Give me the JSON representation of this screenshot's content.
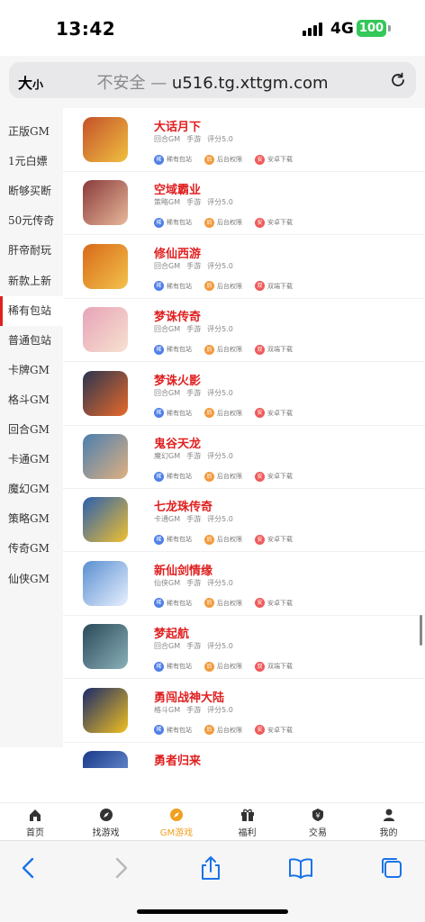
{
  "status": {
    "time": "13:42",
    "network": "4G",
    "battery": "100"
  },
  "browser": {
    "aa_big": "大",
    "aa_small": "小",
    "insecure": "不安全 — ",
    "domain": "u516.tg.xttgm.com"
  },
  "sidebar": {
    "items": [
      {
        "label": "正版GM"
      },
      {
        "label": "1元白嫖"
      },
      {
        "label": "断够买断"
      },
      {
        "label": "50元传奇"
      },
      {
        "label": "肝帝耐玩"
      },
      {
        "label": "新款上新"
      },
      {
        "label": "稀有包站"
      },
      {
        "label": "普通包站"
      },
      {
        "label": "卡牌GM"
      },
      {
        "label": "格斗GM"
      },
      {
        "label": "回合GM"
      },
      {
        "label": "卡通GM"
      },
      {
        "label": "魔幻GM"
      },
      {
        "label": "策略GM"
      },
      {
        "label": "传奇GM"
      },
      {
        "label": "仙侠GM"
      }
    ],
    "active_index": 6
  },
  "games": [
    {
      "name": "大话月下",
      "category": "回合GM",
      "type": "手游",
      "rating": "评分5.0",
      "tags": [
        "稀有包站",
        "后台权限",
        "安卓下载"
      ],
      "tag_icons": [
        "稀",
        "后",
        "安"
      ],
      "colors": [
        "#c4512a",
        "#f0c040"
      ]
    },
    {
      "name": "空域霸业",
      "category": "策略GM",
      "type": "手游",
      "rating": "评分5.0",
      "tags": [
        "稀有包站",
        "后台权限",
        "安卓下载"
      ],
      "tag_icons": [
        "稀",
        "后",
        "安"
      ],
      "colors": [
        "#8a3b3b",
        "#e8b89a"
      ]
    },
    {
      "name": "修仙西游",
      "category": "回合GM",
      "type": "手游",
      "rating": "评分5.0",
      "tags": [
        "稀有包站",
        "后台权限",
        "双端下载"
      ],
      "tag_icons": [
        "稀",
        "后",
        "双"
      ],
      "colors": [
        "#d86a1a",
        "#f3c24a"
      ]
    },
    {
      "name": "梦诛传奇",
      "category": "回合GM",
      "type": "手游",
      "rating": "评分5.0",
      "tags": [
        "稀有包站",
        "后台权限",
        "双端下载"
      ],
      "tag_icons": [
        "稀",
        "后",
        "双"
      ],
      "colors": [
        "#e7a3b8",
        "#f7e2d0"
      ]
    },
    {
      "name": "梦诛火影",
      "category": "回合GM",
      "type": "手游",
      "rating": "评分5.0",
      "tags": [
        "稀有包站",
        "后台权限",
        "安卓下载"
      ],
      "tag_icons": [
        "稀",
        "后",
        "安"
      ],
      "colors": [
        "#2a3550",
        "#e8692a"
      ]
    },
    {
      "name": "鬼谷天龙",
      "category": "魔幻GM",
      "type": "手游",
      "rating": "评分5.0",
      "tags": [
        "稀有包站",
        "后台权限",
        "安卓下载"
      ],
      "tag_icons": [
        "稀",
        "后",
        "安"
      ],
      "colors": [
        "#4a7fb0",
        "#e0b080"
      ]
    },
    {
      "name": "七龙珠传奇",
      "category": "卡通GM",
      "type": "手游",
      "rating": "评分5.0",
      "tags": [
        "稀有包站",
        "后台权限",
        "安卓下载"
      ],
      "tag_icons": [
        "稀",
        "后",
        "安"
      ],
      "colors": [
        "#2a5fb0",
        "#f0c030"
      ]
    },
    {
      "name": "新仙剑情缘",
      "category": "仙侠GM",
      "type": "手游",
      "rating": "评分5.0",
      "tags": [
        "稀有包站",
        "后台权限",
        "安卓下载"
      ],
      "tag_icons": [
        "稀",
        "后",
        "安"
      ],
      "colors": [
        "#5a8fd0",
        "#e8f0ff"
      ]
    },
    {
      "name": "梦起航",
      "category": "回合GM",
      "type": "手游",
      "rating": "评分5.0",
      "tags": [
        "稀有包站",
        "后台权限",
        "双端下载"
      ],
      "tag_icons": [
        "稀",
        "后",
        "双"
      ],
      "colors": [
        "#2a4a5a",
        "#8ab0b8"
      ]
    },
    {
      "name": "勇闯战神大陆",
      "category": "格斗GM",
      "type": "手游",
      "rating": "评分5.0",
      "tags": [
        "稀有包站",
        "后台权限",
        "安卓下载"
      ],
      "tag_icons": [
        "稀",
        "后",
        "安"
      ],
      "colors": [
        "#1a2a6a",
        "#f0c020"
      ]
    },
    {
      "name": "勇者归来",
      "category": "",
      "type": "",
      "rating": "",
      "tags": [],
      "tag_icons": [],
      "colors": [
        "#1a3a8a",
        "#7aa0e0"
      ]
    }
  ],
  "tag_colors": [
    "#4f7fe8",
    "#f29a3c",
    "#ef5a5a"
  ],
  "tabbar": [
    {
      "label": "首页",
      "icon": "home-icon"
    },
    {
      "label": "找游戏",
      "icon": "compass-icon"
    },
    {
      "label": "GM游戏",
      "icon": "gm-icon"
    },
    {
      "label": "福利",
      "icon": "gift-icon"
    },
    {
      "label": "交易",
      "icon": "yen-icon"
    },
    {
      "label": "我的",
      "icon": "user-icon"
    }
  ],
  "tabbar_active_index": 2,
  "accent_red": "#e02020",
  "accent_orange": "#f0a020"
}
